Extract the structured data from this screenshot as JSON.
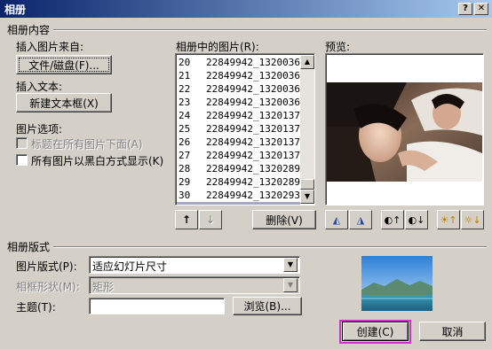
{
  "window": {
    "title": "相册",
    "help_label": "?",
    "close_label": "✕"
  },
  "album_content": {
    "section_label": "相册内容",
    "insert_from_label": "插入图片来自:",
    "file_disk_button": "文件/磁盘(F)...",
    "insert_text_label": "插入文本:",
    "new_textbox_button": "新建文本框(X)",
    "picture_options_label": "图片选项:",
    "caption_below_label": "标题在所有图片下面(A)",
    "black_white_label": "所有图片以黑白方式显示(K)"
  },
  "picture_list": {
    "label": "相册中的图片(R):",
    "items": [
      {
        "num": "20",
        "name": "22849942_1320036"
      },
      {
        "num": "21",
        "name": "22849942_1320036"
      },
      {
        "num": "22",
        "name": "22849942_1320036"
      },
      {
        "num": "23",
        "name": "22849942_1320036"
      },
      {
        "num": "24",
        "name": "22849942_1320137"
      },
      {
        "num": "25",
        "name": "22849942_1320137"
      },
      {
        "num": "26",
        "name": "22849942_1320137"
      },
      {
        "num": "27",
        "name": "22849942_1320137"
      },
      {
        "num": "28",
        "name": "22849942_1320289"
      },
      {
        "num": "29",
        "name": "22849942_1320289"
      },
      {
        "num": "30",
        "name": "22849942_1320293"
      },
      {
        "num": "31",
        "name": "22849942_1320293"
      }
    ],
    "selected_index": 11,
    "up_arrow": "↑",
    "down_arrow": "↓",
    "delete_button": "删除(V)"
  },
  "preview": {
    "label": "预览:"
  },
  "layout": {
    "section_label": "相册版式",
    "picture_layout_label": "图片版式(P):",
    "picture_layout_value": "适应幻灯片尺寸",
    "frame_shape_label": "相框形状(M):",
    "frame_shape_value": "矩形",
    "theme_label": "主题(T):",
    "theme_value": "",
    "browse_button": "浏览(B)..."
  },
  "actions": {
    "create_button": "创建(C)",
    "cancel_button": "取消"
  },
  "colors": {
    "highlight_border": "#cc33cc",
    "title_start": "#0a246a",
    "title_end": "#a6caf0"
  }
}
